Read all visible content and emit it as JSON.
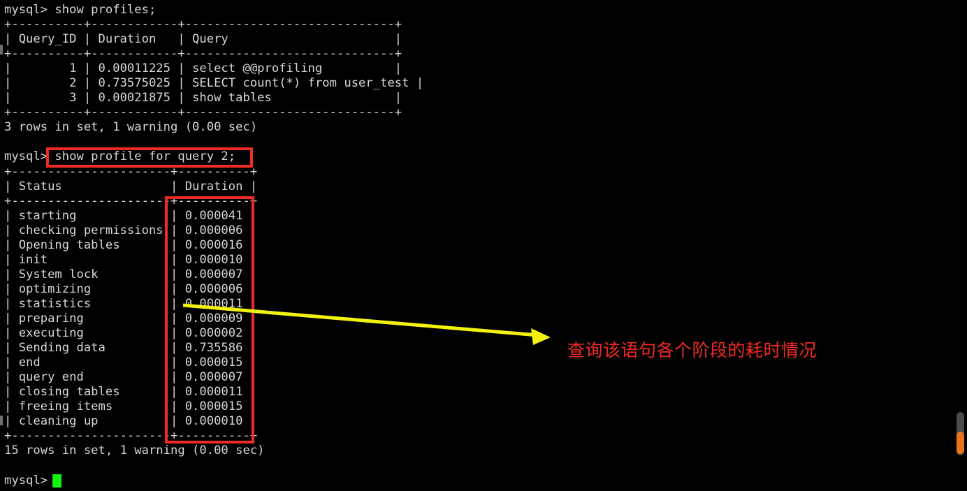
{
  "terminal": {
    "prompt": "mysql>",
    "lines": [
      "mysql> show profiles;",
      "+----------+------------+-----------------------------+",
      "| Query_ID | Duration   | Query                       |",
      "+----------+------------+-----------------------------+",
      "|        1 | 0.00011225 | select @@profiling          |",
      "|        2 | 0.73575025 | SELECT count(*) from user_test |",
      "|        3 | 0.00021875 | show tables                 |",
      "+----------+------------+-----------------------------+",
      "3 rows in set, 1 warning (0.00 sec)",
      "",
      "mysql> show profile for query 2;",
      "+----------------------+----------+",
      "| Status               | Duration |",
      "+----------------------+----------+",
      "| starting             | 0.000041 |",
      "| checking permissions | 0.000006 |",
      "| Opening tables       | 0.000016 |",
      "| init                 | 0.000010 |",
      "| System lock          | 0.000007 |",
      "| optimizing           | 0.000006 |",
      "| statistics           | 0.000011 |",
      "| preparing            | 0.000009 |",
      "| executing            | 0.000002 |",
      "| Sending data         | 0.735586 |",
      "| end                  | 0.000015 |",
      "| query end            | 0.000007 |",
      "| closing tables       | 0.000011 |",
      "| freeing items        | 0.000015 |",
      "| cleaning up          | 0.000010 |",
      "+----------------------+----------+",
      "15 rows in set, 1 warning (0.00 sec)",
      "",
      "mysql> "
    ],
    "commands": {
      "show_profiles": "show profiles;",
      "show_profile_query2": "show profile for query 2;"
    },
    "profiles_table": {
      "headers": [
        "Query_ID",
        "Duration",
        "Query"
      ],
      "rows": [
        [
          "1",
          "0.00011225",
          "select @@profiling"
        ],
        [
          "2",
          "0.73575025",
          "SELECT count(*) from user_test"
        ],
        [
          "3",
          "0.00021875",
          "show tables"
        ]
      ],
      "footer": "3 rows in set, 1 warning (0.00 sec)"
    },
    "profile_table": {
      "headers": [
        "Status",
        "Duration"
      ],
      "rows": [
        [
          "starting",
          "0.000041"
        ],
        [
          "checking permissions",
          "0.000006"
        ],
        [
          "Opening tables",
          "0.000016"
        ],
        [
          "init",
          "0.000010"
        ],
        [
          "System lock",
          "0.000007"
        ],
        [
          "optimizing",
          "0.000006"
        ],
        [
          "statistics",
          "0.000011"
        ],
        [
          "preparing",
          "0.000009"
        ],
        [
          "executing",
          "0.000002"
        ],
        [
          "Sending data",
          "0.735586"
        ],
        [
          "end",
          "0.000015"
        ],
        [
          "query end",
          "0.000007"
        ],
        [
          "closing tables",
          "0.000011"
        ],
        [
          "freeing items",
          "0.000015"
        ],
        [
          "cleaning up",
          "0.000010"
        ]
      ],
      "footer": "15 rows in set, 1 warning (0.00 sec)"
    }
  },
  "annotations": {
    "note_text": "查询该语句各个阶段的耗时情况",
    "highlight_color": "#f02b22",
    "arrow_color": "#f2f20d",
    "note_color": "#ef2a22"
  },
  "colors": {
    "background": "#000000",
    "text": "#d6d7d6",
    "cursor": "#14f214",
    "scrollbar_track": "#4a4a4a",
    "scrollbar_thumb": "#e8731a"
  }
}
